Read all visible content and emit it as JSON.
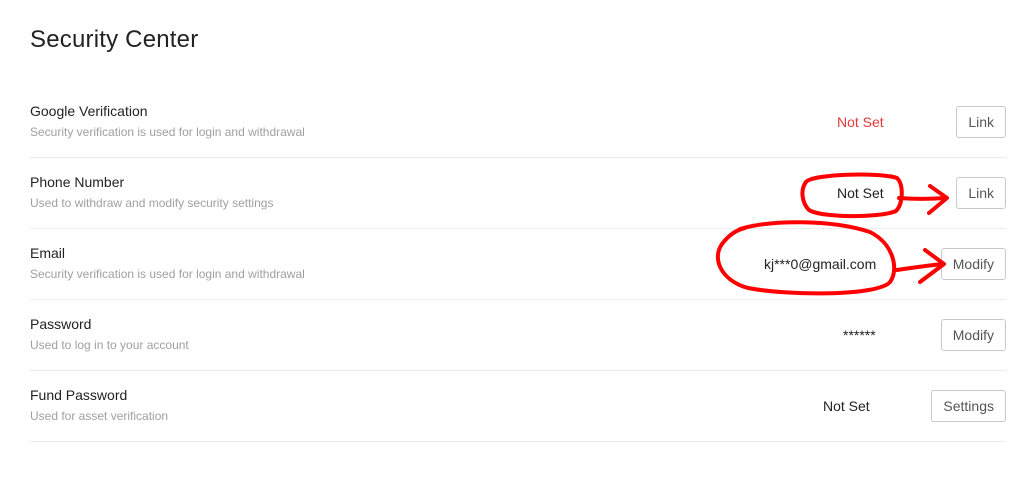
{
  "page": {
    "title": "Security Center"
  },
  "settings": [
    {
      "label": "Google Verification",
      "description": "Security verification is used for login and withdrawal",
      "status": "Not Set",
      "button": "Link"
    },
    {
      "label": "Phone Number",
      "description": "Used to withdraw and modify security settings",
      "status": "Not Set",
      "button": "Link"
    },
    {
      "label": "Email",
      "description": "Security verification is used for login and withdrawal",
      "status": "kj***0@gmail.com",
      "button": "Modify"
    },
    {
      "label": "Password",
      "description": "Used to log in to your account",
      "status": "******",
      "button": "Modify"
    },
    {
      "label": "Fund Password",
      "description": "Used for asset verification",
      "status": "Not Set",
      "button": "Settings"
    }
  ],
  "colors": {
    "not_set_alert": "#e5383b",
    "annotation": "#ff0000"
  }
}
